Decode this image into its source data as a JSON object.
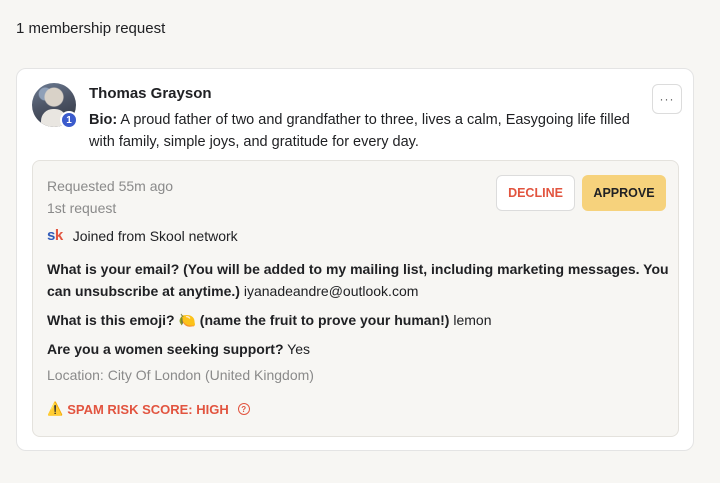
{
  "page": {
    "heading": "1 membership request"
  },
  "request": {
    "user": {
      "name": "Thomas Grayson",
      "level": "1",
      "bio_label": "Bio:",
      "bio_text": "A proud father of two and grandfather to three, lives a calm, Easygoing life filled with family, simple joys, and gratitude for every day."
    },
    "more_label": "···",
    "requested": "Requested 55m ago",
    "request_count": "1st request",
    "actions": {
      "decline": "DECLINE",
      "approve": "APPROVE"
    },
    "source": {
      "icon_s": "s",
      "icon_k": "k",
      "text": "Joined from Skool network"
    },
    "answers": [
      {
        "question": "What is your email? (You will be added to my mailing list, including marketing messages. You can unsubscribe at anytime.)",
        "answer": "iyanadeandre@outlook.com"
      },
      {
        "question": "What is this emoji? 🍋 (name the fruit to prove your human!)",
        "answer": "lemon"
      },
      {
        "question": "Are you a women seeking support?",
        "answer": "Yes"
      }
    ],
    "location": "Location: City Of London (United Kingdom)",
    "spam": {
      "warn_glyph": "⚠️",
      "text": "SPAM RISK SCORE: HIGH",
      "help_glyph": "?"
    }
  },
  "colors": {
    "decline": "#e2543f",
    "approve_bg": "#f6d27c",
    "level_badge": "#3b5bcc",
    "spam": "#e2543f"
  }
}
